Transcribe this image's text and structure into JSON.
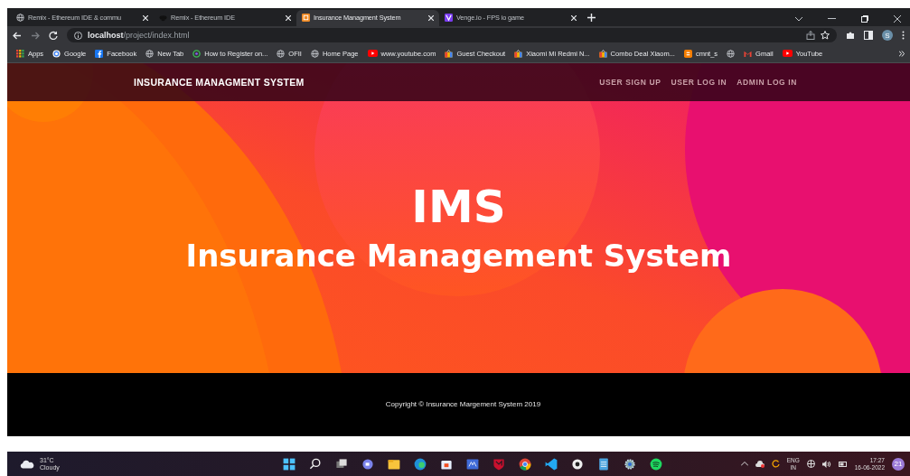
{
  "browser": {
    "tabs": [
      {
        "title": "Remix - Ethereum IDE & commu",
        "selected": false,
        "kind": "globe"
      },
      {
        "title": "Remix - Ethereum IDE",
        "selected": false,
        "kind": "remix"
      },
      {
        "title": "Insurance Managment System",
        "selected": true,
        "kind": "site"
      },
      {
        "title": "Venge.io - FPS io game",
        "selected": false,
        "kind": "venge"
      }
    ],
    "address": "**localhost**/project/index.html",
    "profile": "S",
    "bookmarks": [
      {
        "label": "Apps",
        "kind": "apps"
      },
      {
        "label": "Google",
        "kind": "google"
      },
      {
        "label": "Facebook",
        "kind": "facebook"
      },
      {
        "label": "New Tab",
        "kind": "globe"
      },
      {
        "label": "How to Register on...",
        "kind": "swirl"
      },
      {
        "label": "OFII",
        "kind": "globe"
      },
      {
        "label": "Home Page",
        "kind": "globe"
      },
      {
        "label": "www.youtube.com",
        "kind": "youtube"
      },
      {
        "label": "Guest Checkout",
        "kind": "store"
      },
      {
        "label": "Xiaomi Mi Redmi N...",
        "kind": "store"
      },
      {
        "label": "Combo Deal Xiaom...",
        "kind": "store"
      },
      {
        "label": "cmnt_s",
        "kind": "blogger"
      },
      {
        "kind": "globe"
      },
      {
        "label": "Gmail",
        "kind": "gmail"
      },
      {
        "label": "YouTube",
        "kind": "youtube"
      }
    ]
  },
  "site": {
    "brand": "INSURANCE MANAGMENT SYSTEM",
    "nav": [
      "USER SIGN UP",
      "USER LOG IN",
      "ADMIN LOG IN"
    ],
    "hero_title": "IMS",
    "hero_subtitle": "Insurance Management System",
    "footer": "Copyright © Insurance Margement System 2019"
  },
  "taskbar": {
    "temperature": "31°C",
    "weather": "Cloudy",
    "language": "ENG",
    "region": "IN",
    "time": "17:27",
    "date": "16-06-2022",
    "notifications": "21"
  }
}
